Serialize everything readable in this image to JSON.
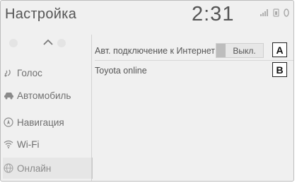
{
  "header": {
    "title": "Настройка",
    "clock": "2:31"
  },
  "sidebar": {
    "items": [
      {
        "label": "Голос",
        "icon": "voice-icon"
      },
      {
        "label": "Автомобиль",
        "icon": "car-icon"
      },
      {
        "label": "Навигация",
        "icon": "navigation-icon"
      },
      {
        "label": "Wi-Fi",
        "icon": "wifi-icon"
      },
      {
        "label": "Онлайн",
        "icon": "globe-icon",
        "selected": true
      }
    ]
  },
  "main": {
    "rows": [
      {
        "label": "Авт. подключение к Интернет",
        "value": "Выкл.",
        "callout": "A"
      },
      {
        "label": "Toyota online",
        "callout": "B"
      }
    ]
  }
}
